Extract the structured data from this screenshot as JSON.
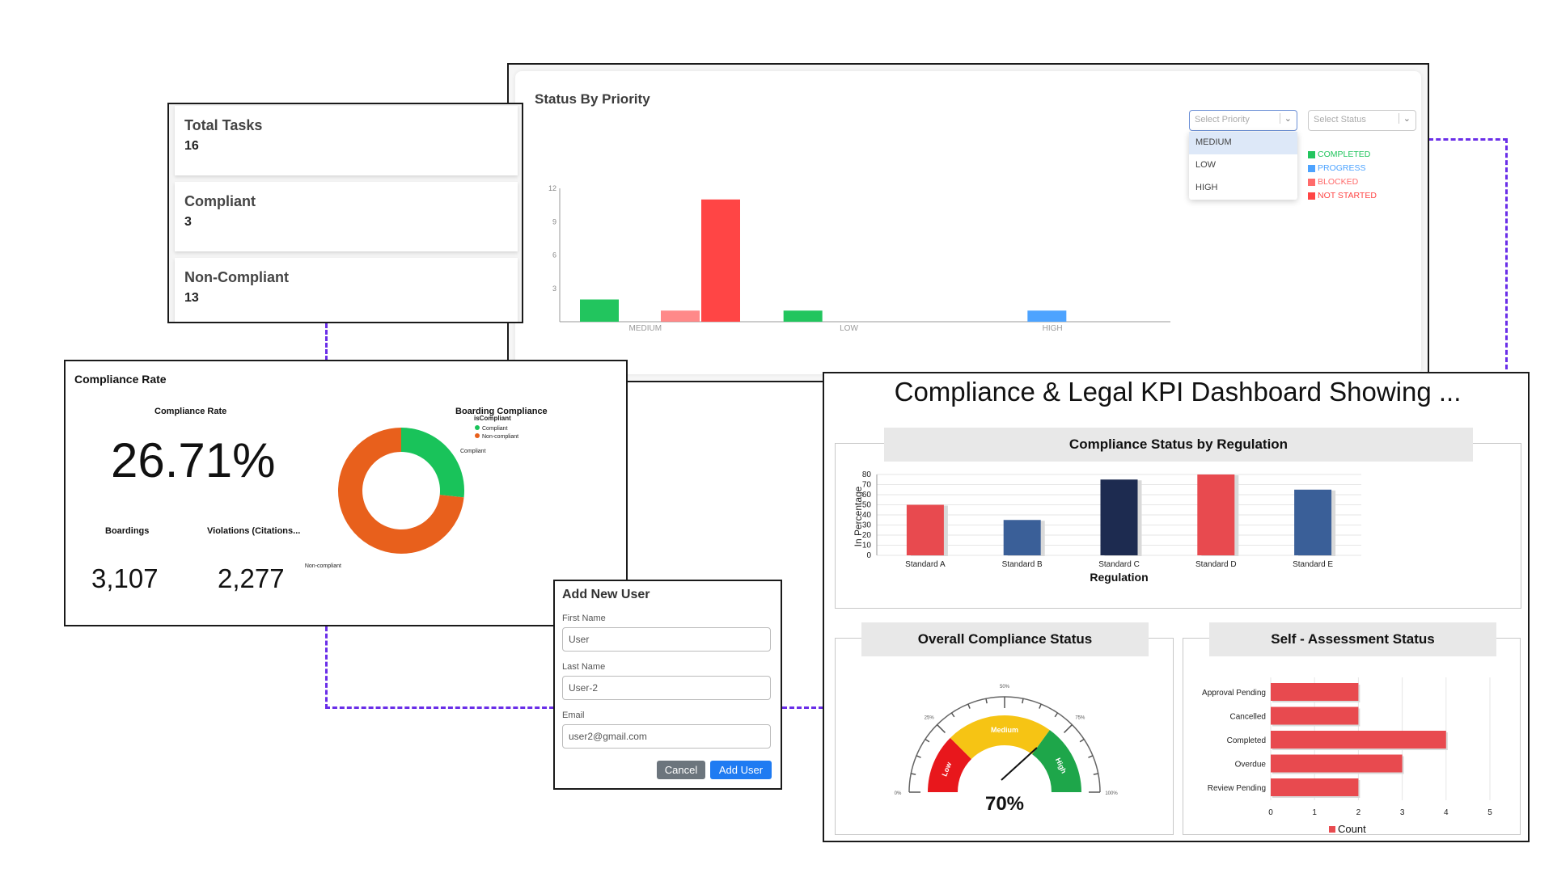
{
  "status_panel": {
    "title": "Status By Priority",
    "priority_placeholder": "Select Priority",
    "status_placeholder": "Select Status",
    "priority_options": [
      "MEDIUM",
      "LOW",
      "HIGH"
    ],
    "legend": [
      {
        "label": "COMPLETED",
        "color": "#22c55e"
      },
      {
        "label": "PROGRESS",
        "color": "#4da3ff"
      },
      {
        "label": "BLOCKED",
        "color": "#ff6b6b"
      },
      {
        "label": "NOT STARTED",
        "color": "#ff4545"
      }
    ],
    "yticks": [
      "12",
      "9",
      "6",
      "3"
    ],
    "categories": [
      "MEDIUM",
      "LOW",
      "HIGH"
    ]
  },
  "totals": [
    {
      "label": "Total Tasks",
      "value": "16"
    },
    {
      "label": "Compliant",
      "value": "3"
    },
    {
      "label": "Non-Compliant",
      "value": "13"
    }
  ],
  "compliance_rate": {
    "panel_title": "Compliance Rate",
    "rate_label": "Compliance Rate",
    "rate_value": "26.71%",
    "boardings_label": "Boardings",
    "boardings_value": "3,107",
    "violations_label": "Violations (Citations...",
    "violations_value": "2,277",
    "donut_title": "Boarding Compliance",
    "legend_title": "isCompliant",
    "legend": [
      {
        "label": "Compliant",
        "color": "#19c35a"
      },
      {
        "label": "Non-compliant",
        "color": "#e8601c"
      }
    ],
    "slice_label_compliant": "Compliant",
    "slice_label_noncompliant": "Non-compliant"
  },
  "add_user": {
    "title": "Add New User",
    "first_name_label": "First Name",
    "first_name_value": "User",
    "last_name_label": "Last Name",
    "last_name_value": "User-2",
    "email_label": "Email",
    "email_value": "user2@gmail.com",
    "cancel_label": "Cancel",
    "add_label": "Add User"
  },
  "kpi": {
    "title": "Compliance & Legal KPI Dashboard Showing ...",
    "regulation_title": "Compliance Status by Regulation",
    "regulation_xlabel": "Regulation",
    "regulation_ylabel": "In Percentage",
    "overall_title": "Overall Compliance Status",
    "gauge_value": "70%",
    "gauge_labels": [
      "Low",
      "Medium",
      "High"
    ],
    "gauge_ticks": [
      "0%",
      "25%",
      "50%",
      "75%",
      "100%"
    ],
    "self_title": "Self - Assessment Status",
    "self_legend": "Count"
  },
  "chart_data": [
    {
      "type": "bar",
      "title": "Status By Priority",
      "categories": [
        "MEDIUM",
        "LOW",
        "HIGH"
      ],
      "ylim": [
        0,
        12
      ],
      "series": [
        {
          "name": "COMPLETED",
          "color": "#22c55e",
          "values": [
            2,
            1,
            0
          ]
        },
        {
          "name": "PROGRESS",
          "color": "#4da3ff",
          "values": [
            0,
            0,
            1
          ]
        },
        {
          "name": "BLOCKED",
          "color": "#ff6b6b",
          "values": [
            1,
            0,
            0
          ]
        },
        {
          "name": "NOT STARTED",
          "color": "#ff4545",
          "values": [
            11,
            0,
            0
          ]
        }
      ]
    },
    {
      "type": "pie",
      "title": "Boarding Compliance",
      "labels": [
        "Compliant",
        "Non-compliant"
      ],
      "values": [
        26.71,
        73.29
      ],
      "colors": [
        "#19c35a",
        "#e8601c"
      ]
    },
    {
      "type": "bar",
      "title": "Compliance Status by Regulation",
      "categories": [
        "Standard A",
        "Standard B",
        "Standard C",
        "Standard D",
        "Standard E"
      ],
      "values": [
        50,
        35,
        75,
        80,
        65
      ],
      "colors": [
        "#e84a4f",
        "#3a5f98",
        "#1d2b50",
        "#e84a4f",
        "#3a5f98"
      ],
      "xlabel": "Regulation",
      "ylabel": "In Percentage",
      "ylim": [
        0,
        80
      ],
      "yticks": [
        0,
        10,
        20,
        30,
        40,
        50,
        60,
        70,
        80
      ]
    },
    {
      "type": "bar",
      "orientation": "horizontal",
      "title": "Self - Assessment Status",
      "categories": [
        "Approval Pending",
        "Cancelled",
        "Completed",
        "Overdue",
        "Review Pending"
      ],
      "values": [
        2,
        2,
        4,
        3,
        2
      ],
      "series_name": "Count",
      "color": "#e84a4f",
      "xlim": [
        0,
        5
      ],
      "xticks": [
        0,
        1,
        2,
        3,
        4,
        5
      ]
    }
  ]
}
